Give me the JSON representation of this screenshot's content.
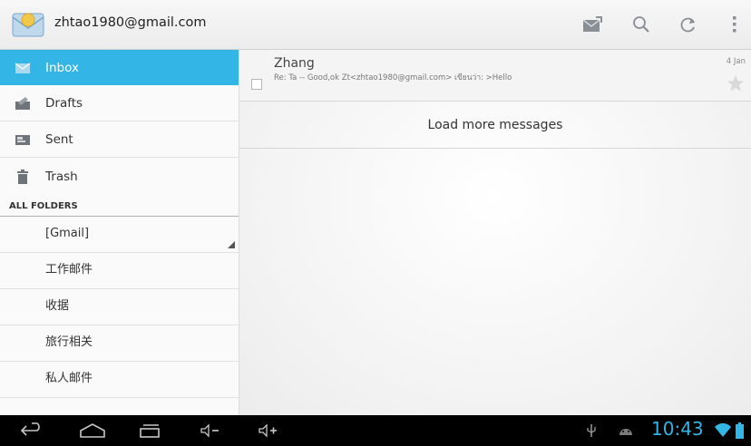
{
  "app": {
    "account": "zhtao1980@gmail.com"
  },
  "colors": {
    "accent": "#33b5e5",
    "selected_text": "#ffffff",
    "system_bar": "#000000"
  },
  "action_bar": {
    "icons": [
      {
        "name": "compose-icon"
      },
      {
        "name": "search-icon"
      },
      {
        "name": "refresh-icon"
      },
      {
        "name": "overflow-menu-icon"
      }
    ]
  },
  "sidebar": {
    "items": [
      {
        "label": "Inbox",
        "icon": "inbox-icon",
        "selected": true
      },
      {
        "label": "Drafts",
        "icon": "drafts-icon",
        "selected": false
      },
      {
        "label": "Sent",
        "icon": "sent-icon",
        "selected": false
      },
      {
        "label": "Trash",
        "icon": "trash-icon",
        "selected": false
      }
    ],
    "section_header": "ALL FOLDERS",
    "folders": [
      "[Gmail]",
      "工作邮件",
      "收据",
      "旅行相关",
      "私人邮件"
    ]
  },
  "messages": [
    {
      "sender": "Zhang",
      "snippet": "Re: Ta -- Good,ok Zt<zhtao1980@gmail.com> เขียนว่า: >Hello",
      "date": "4 Jan",
      "starred": false
    }
  ],
  "load_more": "Load more messages",
  "system_bar": {
    "buttons": [
      "back-icon",
      "home-icon",
      "recent-apps-icon",
      "volume-down-icon",
      "volume-up-icon"
    ],
    "status_icons": [
      "usb-icon",
      "android-debug-icon",
      "wifi-icon",
      "battery-icon"
    ],
    "time": "10:43"
  }
}
